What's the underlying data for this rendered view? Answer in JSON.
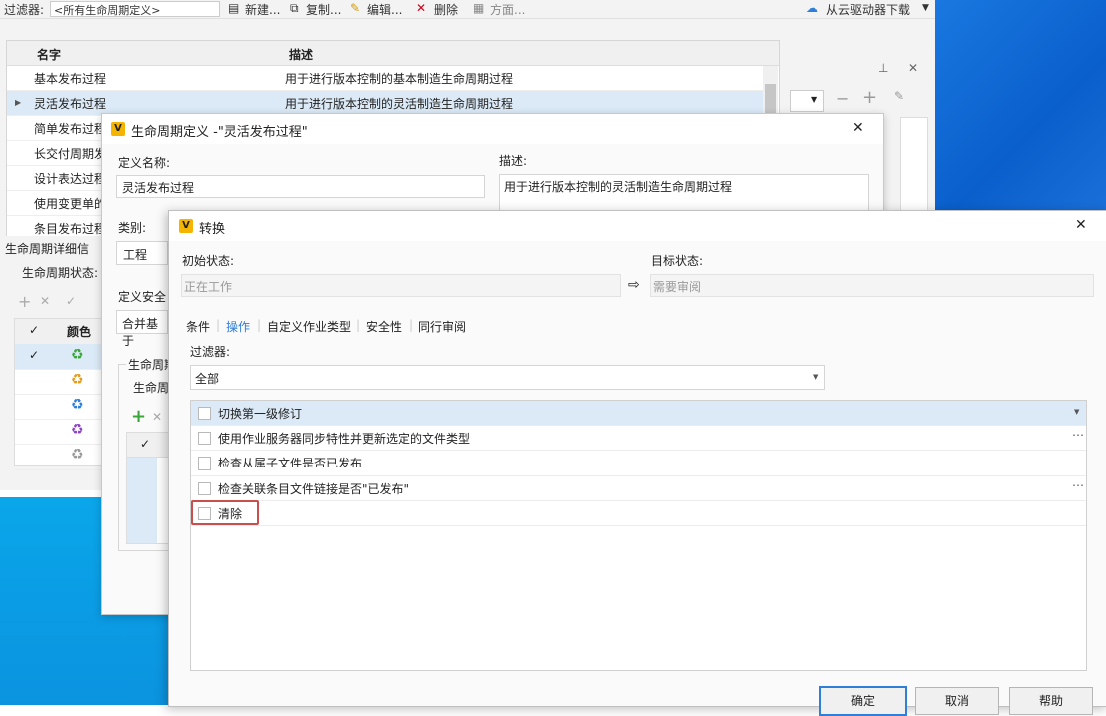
{
  "toolbar": {
    "filter_label": "过滤器:",
    "filter_value": "<所有生命周期定义>",
    "new": "新建...",
    "copy": "复制...",
    "edit": "编辑...",
    "delete": "删除",
    "scheme": "方面...",
    "cloud": "从云驱动器下载"
  },
  "grid": {
    "headers": [
      "名字",
      "描述"
    ],
    "rows": [
      {
        "name": "基本发布过程",
        "desc": "用于进行版本控制的基本制造生命周期过程"
      },
      {
        "name": "灵活发布过程",
        "desc": "用于进行版本控制的灵活制造生命周期过程"
      },
      {
        "name": "简单发布过程",
        "desc": ""
      },
      {
        "name": "长交付周期发",
        "desc": ""
      },
      {
        "name": "设计表达过程",
        "desc": ""
      },
      {
        "name": "使用变更单的",
        "desc": ""
      },
      {
        "name": "条目发布过程",
        "desc": ""
      }
    ]
  },
  "lower": {
    "section": "生命周期详细信",
    "states_label": "生命周期状态:",
    "color_header": "颜色"
  },
  "dlg1": {
    "title": "生命周期定义 -\"灵活发布过程\"",
    "name_label": "定义名称:",
    "name_value": "灵活发布过程",
    "desc_label": "描述:",
    "desc_value": "用于进行版本控制的灵活制造生命周期过程",
    "category_label": "类别:",
    "category_value": "工程",
    "security_label": "定义安全",
    "security_value": "合并基于",
    "group_label": "生命周期",
    "states_label": "生命周"
  },
  "dlg2": {
    "title": "转换",
    "from_label": "初始状态:",
    "from_value": "正在工作",
    "to_label": "目标状态:",
    "to_value": "需要审阅",
    "tabs": [
      "条件",
      "操作",
      "自定义作业类型",
      "安全性",
      "同行审阅"
    ],
    "filter_label": "过滤器:",
    "filter_value": "全部",
    "items": [
      "切换第一级修订",
      "使用作业服务器同步特性并更新选定的文件类型",
      "检查从属子文件是否已发布",
      "检查关联条目文件链接是否\"已发布\"",
      "清除"
    ],
    "ok": "确定",
    "cancel": "取消",
    "help": "帮助"
  },
  "colors": {
    "accent": "#2f7ed8",
    "highlight": "#c94f4f",
    "selection": "#dbeaf6"
  }
}
